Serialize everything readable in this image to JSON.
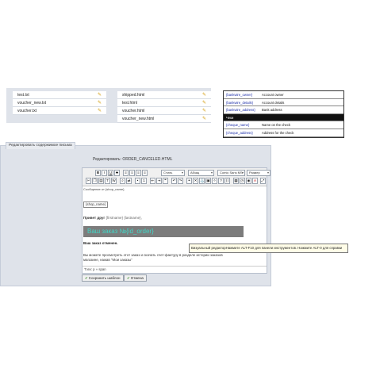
{
  "files_col1": [
    "test.txt",
    "voucher_new.txt",
    "voucher.txt"
  ],
  "files_col2": [
    "shipped.html",
    "test.html",
    "voucher.html",
    "voucher_new.html"
  ],
  "vars": [
    {
      "key": "{bankwire_owner}",
      "value": "Account owner"
    },
    {
      "key": "{bankwire_details}",
      "value": "Account details"
    },
    {
      "key": "{bankwire_address}",
      "value": "Bank address"
    },
    {
      "key": "Чеки",
      "value": ""
    },
    {
      "key": "{cheque_name}",
      "value": "Name on the check"
    },
    {
      "key": "{cheque_address}",
      "value": "Address for the check"
    }
  ],
  "panel_tab": "Редактировать содержимое письма",
  "edit_title": "Редактировать: ORDER_CANCELED.HTML",
  "toolbar": {
    "style_select": "Стиль",
    "format_select": "Абзац",
    "font_select": "Comic Sans MS",
    "size_select": "Размер"
  },
  "content": {
    "breadcrumb": "Сообщение от {shop_name}",
    "shop_name_var": "{shop_name}",
    "greeting_label": "Привет друг",
    "greeting_tokens": "{firstname} {lastname},",
    "banner_text": "Ваш заказ №{id_order}",
    "order_cancelled": "Ваш заказ отменен.",
    "body_line1": "Вы можете просмотреть этот заказ и скачать счет-фактуру в разделе истории заказов",
    "body_line2": "магазине, нажав \"Мои заказы\""
  },
  "tooltip": "Визуальный редакторНажмите ALT-F10 для панели инструментов. Нажмите ALT-0 для справки",
  "statusbar": "Тэги: p » span",
  "buttons": {
    "save": "Сохранить шаблон",
    "cancel": "Отмена"
  }
}
